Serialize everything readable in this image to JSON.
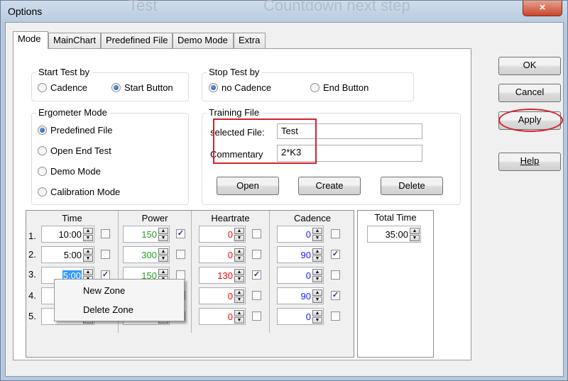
{
  "window": {
    "title": "Options",
    "bg_text_left": "Test",
    "bg_text_right": "Countdown next step",
    "close_glyph": "×"
  },
  "tabs": [
    "Mode",
    "MainChart",
    "Predefined File",
    "Demo Mode",
    "Extra"
  ],
  "start_test": {
    "legend": "Start Test by",
    "options": [
      "Cadence",
      "Start Button"
    ],
    "selected": "Start Button"
  },
  "stop_test": {
    "legend": "Stop Test by",
    "options": [
      "no Cadence",
      "End Button"
    ],
    "selected": "no Cadence"
  },
  "ergometer_mode": {
    "legend": "Ergometer Mode",
    "options": [
      "Predefined File",
      "Open End Test",
      "Demo Mode",
      "Calibration Mode"
    ],
    "selected": "Predefined File"
  },
  "training_file": {
    "legend": "Training File",
    "selected_label": "selected File:",
    "selected_value": "Test",
    "commentary_label": "Commentary",
    "commentary_value": "2*K3",
    "buttons": [
      "Open",
      "Create",
      "Delete"
    ]
  },
  "zones": {
    "headers": [
      "Time",
      "Power",
      "Heartrate",
      "Cadence"
    ],
    "row_numbers": [
      "1.",
      "2.",
      "3.",
      "4.",
      "5."
    ],
    "time": [
      "10:00",
      "5:00",
      "5:00",
      "",
      ""
    ],
    "time_checked": [
      false,
      false,
      true,
      false,
      false
    ],
    "power": [
      "150",
      "300",
      "150",
      "",
      ""
    ],
    "power_checked": [
      true,
      false,
      false,
      false,
      true
    ],
    "heartrate": [
      "0",
      "0",
      "130",
      "0",
      "0"
    ],
    "heartrate_checked": [
      false,
      false,
      true,
      false,
      false
    ],
    "cadence": [
      "0",
      "90",
      "0",
      "90",
      "0"
    ],
    "cadence_checked": [
      false,
      true,
      false,
      true,
      false
    ]
  },
  "total_time": {
    "label": "Total Time",
    "value": "35:00"
  },
  "context_menu": [
    "New Zone",
    "Delete Zone"
  ],
  "side_buttons": {
    "ok": "OK",
    "cancel": "Cancel",
    "apply": "Apply",
    "help": "Help"
  },
  "colors": {
    "highlight": "#d2232a",
    "power": "#22a022",
    "heartrate": "#ff0000",
    "cadence": "#1a1aff",
    "selection": "#3399ff"
  }
}
